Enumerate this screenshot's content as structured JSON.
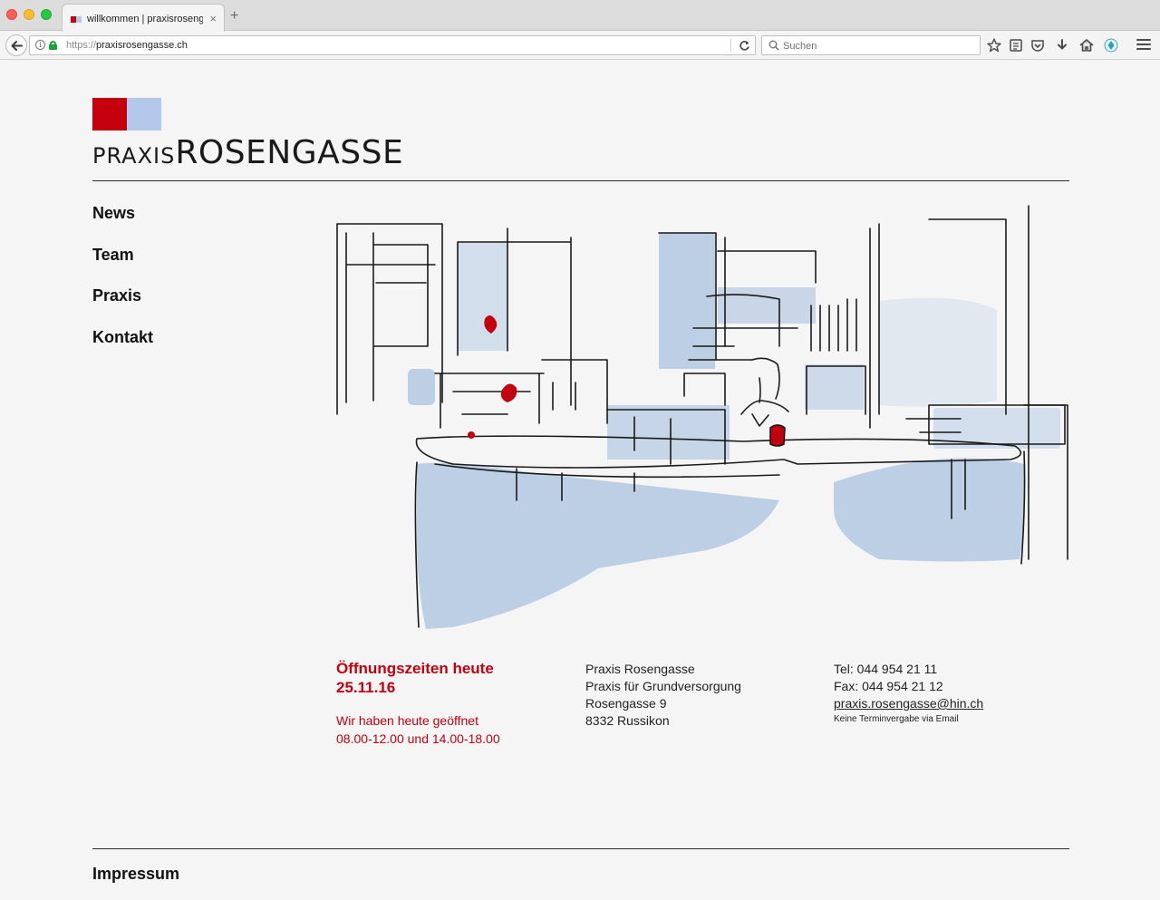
{
  "browser": {
    "tab_title": "willkommen | praxisrosenga...",
    "tab_close": "×",
    "new_tab": "+",
    "url_scheme": "https://",
    "url_host": "praxisrosengasse.ch",
    "search_placeholder": "Suchen"
  },
  "brand": {
    "logo_praxis": "PRAXIS",
    "logo_rosengasse": "ROSENGASSE",
    "red": "#c4000f",
    "blue": "#b3c8ea"
  },
  "nav": {
    "items": [
      {
        "label": "News"
      },
      {
        "label": "Team"
      },
      {
        "label": "Praxis"
      },
      {
        "label": "Kontakt"
      }
    ]
  },
  "hours": {
    "heading": "Öffnungszeiten heute",
    "date": "25.11.16",
    "status": "Wir haben heute geöffnet",
    "times": "08.00-12.00 und 14.00-18.00"
  },
  "address": {
    "line1": "Praxis Rosengasse",
    "line2": "Praxis für Grundversorgung",
    "line3": "Rosengasse 9",
    "line4": "8332 Russikon"
  },
  "contact": {
    "tel": "Tel: 044 954 21 11",
    "fax": "Fax: 044 954 21 12",
    "email": "praxis.rosengasse@hin.ch",
    "note": "Keine Terminvergabe via Email"
  },
  "footer": {
    "impressum": "Impressum"
  }
}
